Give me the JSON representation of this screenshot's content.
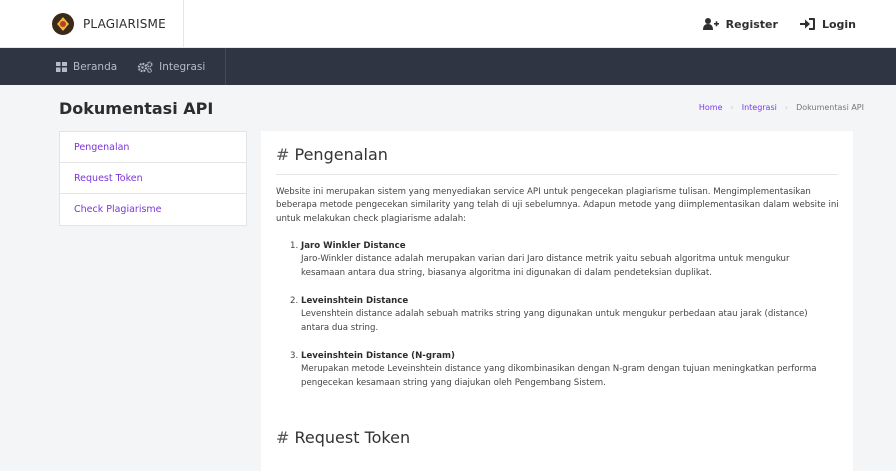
{
  "brand": {
    "name": "PLAGIARISME"
  },
  "auth": {
    "register": "Register",
    "login": "Login"
  },
  "nav": [
    {
      "label": "Beranda",
      "icon": "dashboard-icon"
    },
    {
      "label": "Integrasi",
      "icon": "cogs-icon"
    }
  ],
  "page": {
    "title": "Dokumentasi API"
  },
  "breadcrumb": {
    "home": "Home",
    "integrasi": "Integrasi",
    "current": "Dokumentasi API"
  },
  "sidebar": {
    "items": [
      {
        "label": "Pengenalan"
      },
      {
        "label": "Request Token"
      },
      {
        "label": "Check Plagiarisme"
      }
    ]
  },
  "content": {
    "hash": "#",
    "section1_title": "Pengenalan",
    "intro": "Website ini merupakan sistem yang menyediakan service API untuk pengecekan plagiarisme tulisan. Mengimplementasikan beberapa metode pengecekan similarity yang telah di uji sebelumnya. Adapun metode yang diimplementasikan dalam website ini untuk melakukan check plagiarisme adalah:",
    "methods": [
      {
        "num": "1.",
        "title": "Jaro Winkler Distance",
        "desc": "Jaro-Winkler distance adalah merupakan varian dari Jaro distance metrik yaitu sebuah algoritma untuk mengukur kesamaan antara dua string, biasanya algoritma ini digunakan di dalam pendeteksian duplikat."
      },
      {
        "num": "2.",
        "title": "Leveinshtein Distance",
        "desc": "Levenshtein distance adalah sebuah matriks string yang digunakan untuk mengukur perbedaan atau jarak (distance) antara dua string."
      },
      {
        "num": "3.",
        "title": "Leveinshtein Distance (N-gram)",
        "desc": "Merupakan metode Leveinshtein distance yang dikombinasikan dengan N-gram dengan tujuan meningkatkan performa pengecekan kesamaan string yang diajukan oleh Pengembang Sistem."
      }
    ],
    "section2_title": "Request Token"
  },
  "colors": {
    "accent": "#7c3aed",
    "navbar": "#2f3542",
    "background": "#f4f5f7"
  }
}
